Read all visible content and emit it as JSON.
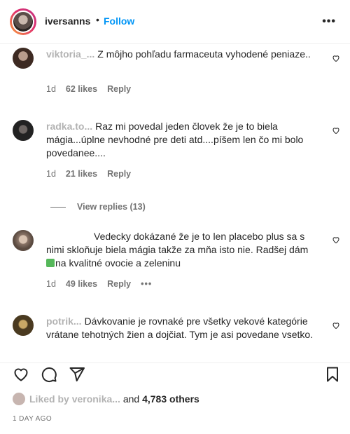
{
  "header": {
    "username": "iversanns",
    "separator": "•",
    "follow_label": "Follow",
    "more_label": "•••"
  },
  "comments": [
    {
      "user": "viktoria_...",
      "text": "Z môjho pohľadu farmaceuta vyhodené peniaze..",
      "age": "1d",
      "likes": "62 likes",
      "reply": "Reply"
    },
    {
      "user": "radka.to...",
      "text": "Raz mi povedal jeden človek že je to biela mágia...úplne nevhodné pre deti atd....píšem len čo mi bolo povedanee....",
      "age": "1d",
      "likes": "21 likes",
      "reply": "Reply"
    },
    {
      "user": "",
      "text": "Vedecky dokázané že je to len placebo plus sa s nimi skloňuje biela mágia takže za mňa isto nie. Radšej dám",
      "text_cont": "na kvalitné ovocie a zeleninu",
      "age": "1d",
      "likes": "49 likes",
      "reply": "Reply",
      "more": "•••"
    },
    {
      "user": "potrik...",
      "text": "Dávkovanie je rovnaké pre všetky vekové kategórie vrátane tehotných žien a dojčiat. Tym je asi povedane vsetko.",
      "age": "",
      "likes": "",
      "reply": ""
    }
  ],
  "view_replies": "View replies (13)",
  "footer": {
    "liked_by_prefix": "Liked by",
    "liked_by_user": "veronika...",
    "liked_and": "and",
    "liked_others": "4,783 others",
    "time": "1 DAY AGO"
  },
  "colors": {
    "accent": "#0095f6",
    "text": "#262626",
    "muted": "#737373"
  }
}
